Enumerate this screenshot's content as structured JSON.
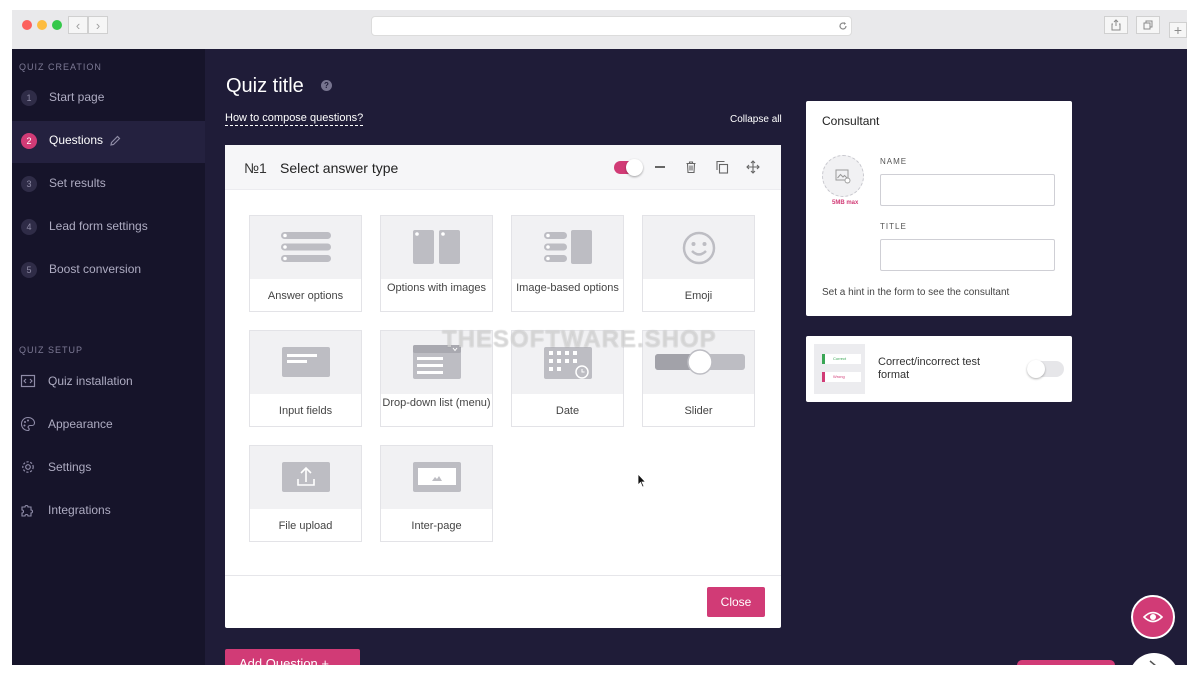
{
  "browser": {
    "url": ""
  },
  "sidebar": {
    "creation_header": "QUIZ CREATION",
    "creation_items": [
      {
        "num": "1",
        "label": "Start page"
      },
      {
        "num": "2",
        "label": "Questions"
      },
      {
        "num": "3",
        "label": "Set results"
      },
      {
        "num": "4",
        "label": "Lead form settings"
      },
      {
        "num": "5",
        "label": "Boost conversion"
      }
    ],
    "setup_header": "QUIZ SETUP",
    "setup_items": [
      {
        "label": "Quiz installation",
        "icon": "code-icon"
      },
      {
        "label": "Appearance",
        "icon": "palette-icon"
      },
      {
        "label": "Settings",
        "icon": "gear-icon"
      },
      {
        "label": "Integrations",
        "icon": "puzzle-icon"
      }
    ]
  },
  "main": {
    "title": "Quiz title",
    "help_glyph": "?",
    "how_link": "How to compose questions?",
    "collapse_all": "Collapse all",
    "question": {
      "number": "№1",
      "title": "Select answer type",
      "enabled": true
    },
    "answer_types": [
      {
        "label": "Answer options",
        "icon": "list-icon"
      },
      {
        "label": "Options with images",
        "icon": "image-columns-icon"
      },
      {
        "label": "Image-based options",
        "icon": "list-image-icon"
      },
      {
        "label": "Emoji",
        "icon": "smiley-icon"
      },
      {
        "label": "Input fields",
        "icon": "input-field-icon"
      },
      {
        "label": "Drop-down list (menu)",
        "icon": "dropdown-icon"
      },
      {
        "label": "Date",
        "icon": "calendar-icon"
      },
      {
        "label": "Slider",
        "icon": "slider-icon"
      },
      {
        "label": "File upload",
        "icon": "upload-icon"
      },
      {
        "label": "Inter-page",
        "icon": "inter-page-icon"
      }
    ],
    "close_label": "Close",
    "add_question_label": "Add Question  +"
  },
  "consultant": {
    "title": "Consultant",
    "avatar_hint": "5MB max",
    "name_label": "NAME",
    "name_value": "",
    "title_label": "TITLE",
    "title_value": "",
    "hint": "Set a hint in the form to see the consultant"
  },
  "correct_format": {
    "label": "Correct/incorrect test format",
    "enabled": false,
    "thumb_correct": "Correct",
    "thumb_wrong": "Wrong"
  },
  "watermark": "THESOFTWARE.SHOP",
  "colors": {
    "accent": "#d13b76",
    "sidebar": "#16142a",
    "background": "#1f1c38"
  }
}
